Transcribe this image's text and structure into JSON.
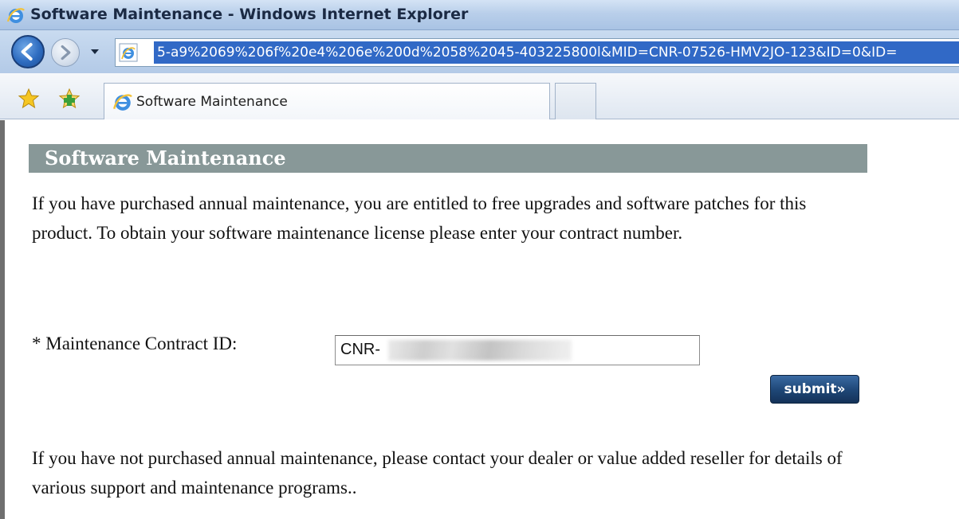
{
  "window": {
    "title": "Software Maintenance - Windows Internet Explorer"
  },
  "address_bar": {
    "url": "5-a9%2069%206f%20e4%206e%200d%2058%2045-403225800l&MID=CNR-07526-HMV2JO-123&ID=0&ID="
  },
  "tabs": [
    {
      "label": "Software Maintenance"
    }
  ],
  "page": {
    "header": "Software Maintenance",
    "intro": "If you have purchased annual maintenance, you are entitled to free upgrades and software patches for this product. To obtain your software maintenance license please enter your contract number.",
    "contract_label": "* Maintenance Contract ID:",
    "contract_value": "CNR-",
    "submit_label": "submit»",
    "footer": "If you have not purchased annual maintenance, please contact your dealer or value added reseller for details of various support and maintenance programs.."
  },
  "icons": {
    "window": "ie-logo-icon",
    "back": "back-arrow-icon",
    "forward": "forward-arrow-icon",
    "favorites": "favorites-star-icon",
    "add_favorites": "add-favorites-icon"
  },
  "colors": {
    "section_header_bg": "#889898",
    "submit_bg": "#1e4676",
    "url_highlight": "#3169c6"
  }
}
